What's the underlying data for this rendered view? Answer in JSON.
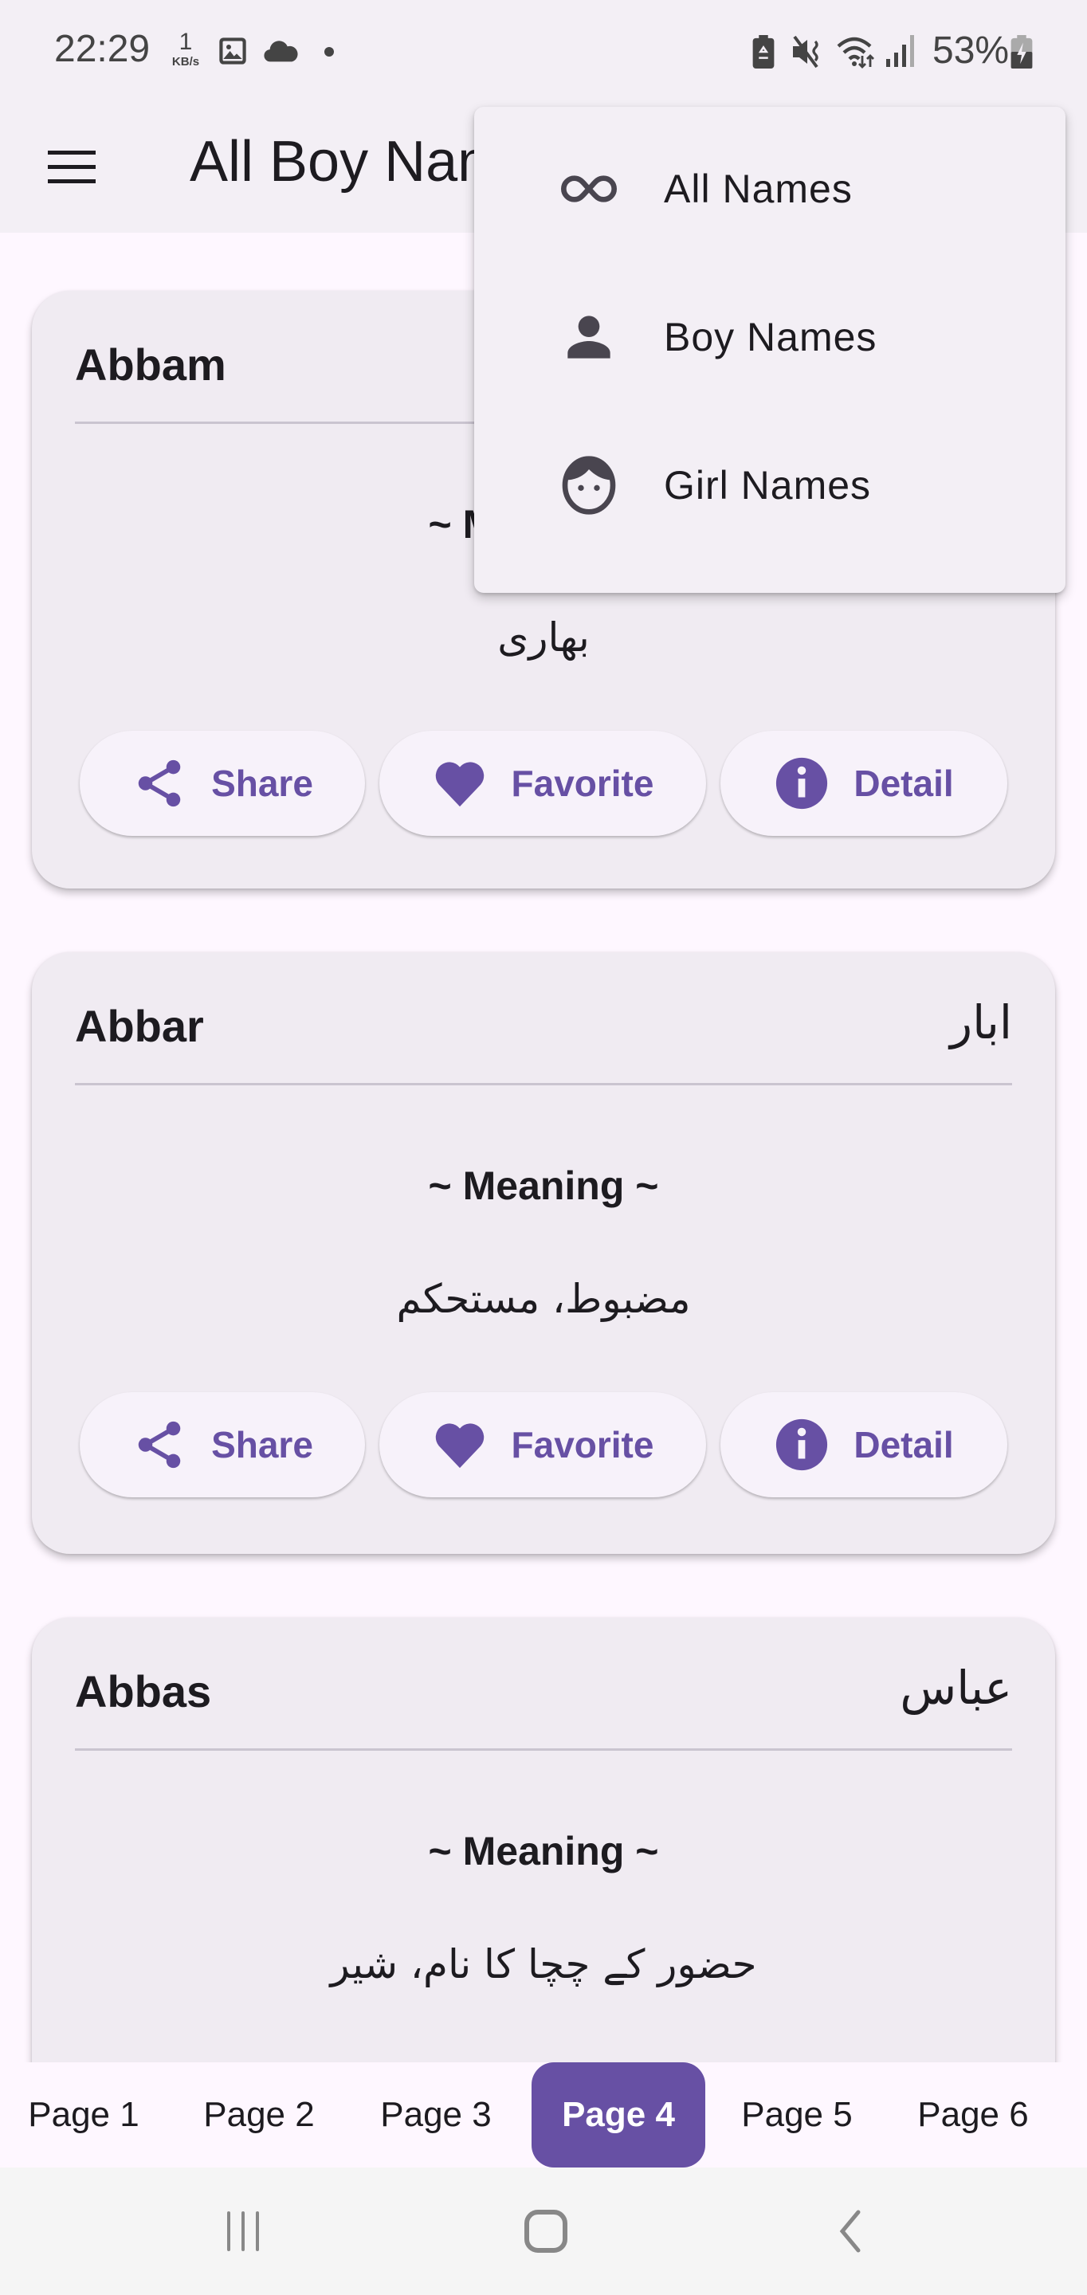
{
  "status_bar": {
    "time": "22:29",
    "net_speed_value": "1",
    "net_speed_unit": "KB/s",
    "battery_percent": "53%",
    "icons": [
      "gallery-icon",
      "cloud-icon",
      "dot-icon",
      "battery-saver-icon",
      "mute-icon",
      "wifi-icon",
      "signal-icon",
      "battery-charging-icon"
    ]
  },
  "app_bar": {
    "title": "All Boy Names",
    "menu_icon": "hamburger-menu-icon"
  },
  "popup_menu": {
    "items": [
      {
        "label": "All Names",
        "icon": "infinity-icon"
      },
      {
        "label": "Boy Names",
        "icon": "person-icon"
      },
      {
        "label": "Girl Names",
        "icon": "face-icon"
      }
    ]
  },
  "cards": [
    {
      "name_en": "Abbam",
      "name_ur": "",
      "meaning_label": "~ Meaning ~",
      "meaning": "بھاری",
      "actions": {
        "share": "Share",
        "favorite": "Favorite",
        "detail": "Detail"
      }
    },
    {
      "name_en": "Abbar",
      "name_ur": "ابار",
      "meaning_label": "~ Meaning ~",
      "meaning": "مضبوط، مستحکم",
      "actions": {
        "share": "Share",
        "favorite": "Favorite",
        "detail": "Detail"
      }
    },
    {
      "name_en": "Abbas",
      "name_ur": "عباس",
      "meaning_label": "~ Meaning ~",
      "meaning": "حضور کے چچا کا نام، شیر"
    }
  ],
  "pagination": {
    "pages": [
      "Page 1",
      "Page 2",
      "Page 3",
      "Page 4",
      "Page 5",
      "Page 6"
    ],
    "current": "Page 4"
  },
  "nav_bar": {
    "buttons": [
      "recents-icon",
      "home-icon",
      "back-icon"
    ]
  },
  "theme": {
    "accent": "#6750a4",
    "surface": "#f3eff5",
    "card": "#f0ebf2",
    "background": "#fef7ff"
  }
}
